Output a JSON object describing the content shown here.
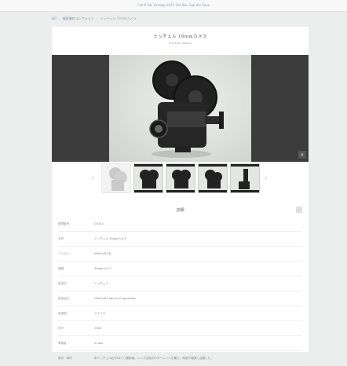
{
  "topbar": {
    "text": "Cell-fi Die Vintage 2025 Oie Nou Sub dio Seue"
  },
  "breadcrumb": {
    "items": [
      "HO",
      "撮影機材コレクション",
      "ミッチェル 16mmカメラ"
    ]
  },
  "product": {
    "title": "ミッチェル 16mmカメラ",
    "subtitle": "Mitchell camera"
  },
  "viewer": {
    "zoom_icon": "search-icon"
  },
  "thumbnails": {
    "count": 5,
    "prev_icon": "chevron-left-icon",
    "next_icon": "chevron-right-icon"
  },
  "details": {
    "heading": "詳細",
    "toggle_label": "-",
    "rows": [
      {
        "key": "管理番号",
        "value": "C0243"
      },
      {
        "key": "名称",
        "value": "ミッチェル 16mmカメラ"
      },
      {
        "key": "フリガナ",
        "value": "Mitchell Sh.."
      },
      {
        "key": "種類",
        "value": "16mmカメラ"
      },
      {
        "key": "製造年",
        "value": "ミッチェル"
      },
      {
        "key": "製造会社",
        "value": "Mitchell Camera Corporation"
      },
      {
        "key": "製造国",
        "value": "アメリカ"
      },
      {
        "key": "年代",
        "value": "1945"
      },
      {
        "key": "寄贈者",
        "value": "Yi Ako"
      },
      {
        "key": "解説・備考",
        "value": "米ミッチェル社の16ミリ撮影機。レンズ交換式のターレットを備え、映画や報道で活躍した。"
      }
    ]
  }
}
